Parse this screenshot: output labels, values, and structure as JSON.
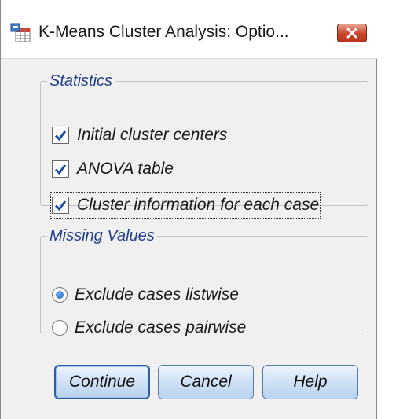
{
  "window": {
    "title": "K-Means Cluster Analysis: Optio...",
    "icon": "spss-table-icon",
    "close_icon": "close-icon"
  },
  "statistics": {
    "legend": "Statistics",
    "options": [
      {
        "label": "Initial cluster centers",
        "checked": true
      },
      {
        "label": "ANOVA table",
        "checked": true
      },
      {
        "label": "Cluster information for each case",
        "checked": true,
        "focused": true
      }
    ]
  },
  "missing_values": {
    "legend": "Missing Values",
    "options": [
      {
        "label": "Exclude cases listwise",
        "selected": true
      },
      {
        "label": "Exclude cases pairwise",
        "selected": false
      }
    ]
  },
  "buttons": {
    "continue": "Continue",
    "cancel": "Cancel",
    "help": "Help"
  },
  "colors": {
    "legend_text": "#1f3d8c",
    "check_mark": "#1e4fa3",
    "close_button": "#c8452a",
    "button_face": "#cfe1f5"
  }
}
